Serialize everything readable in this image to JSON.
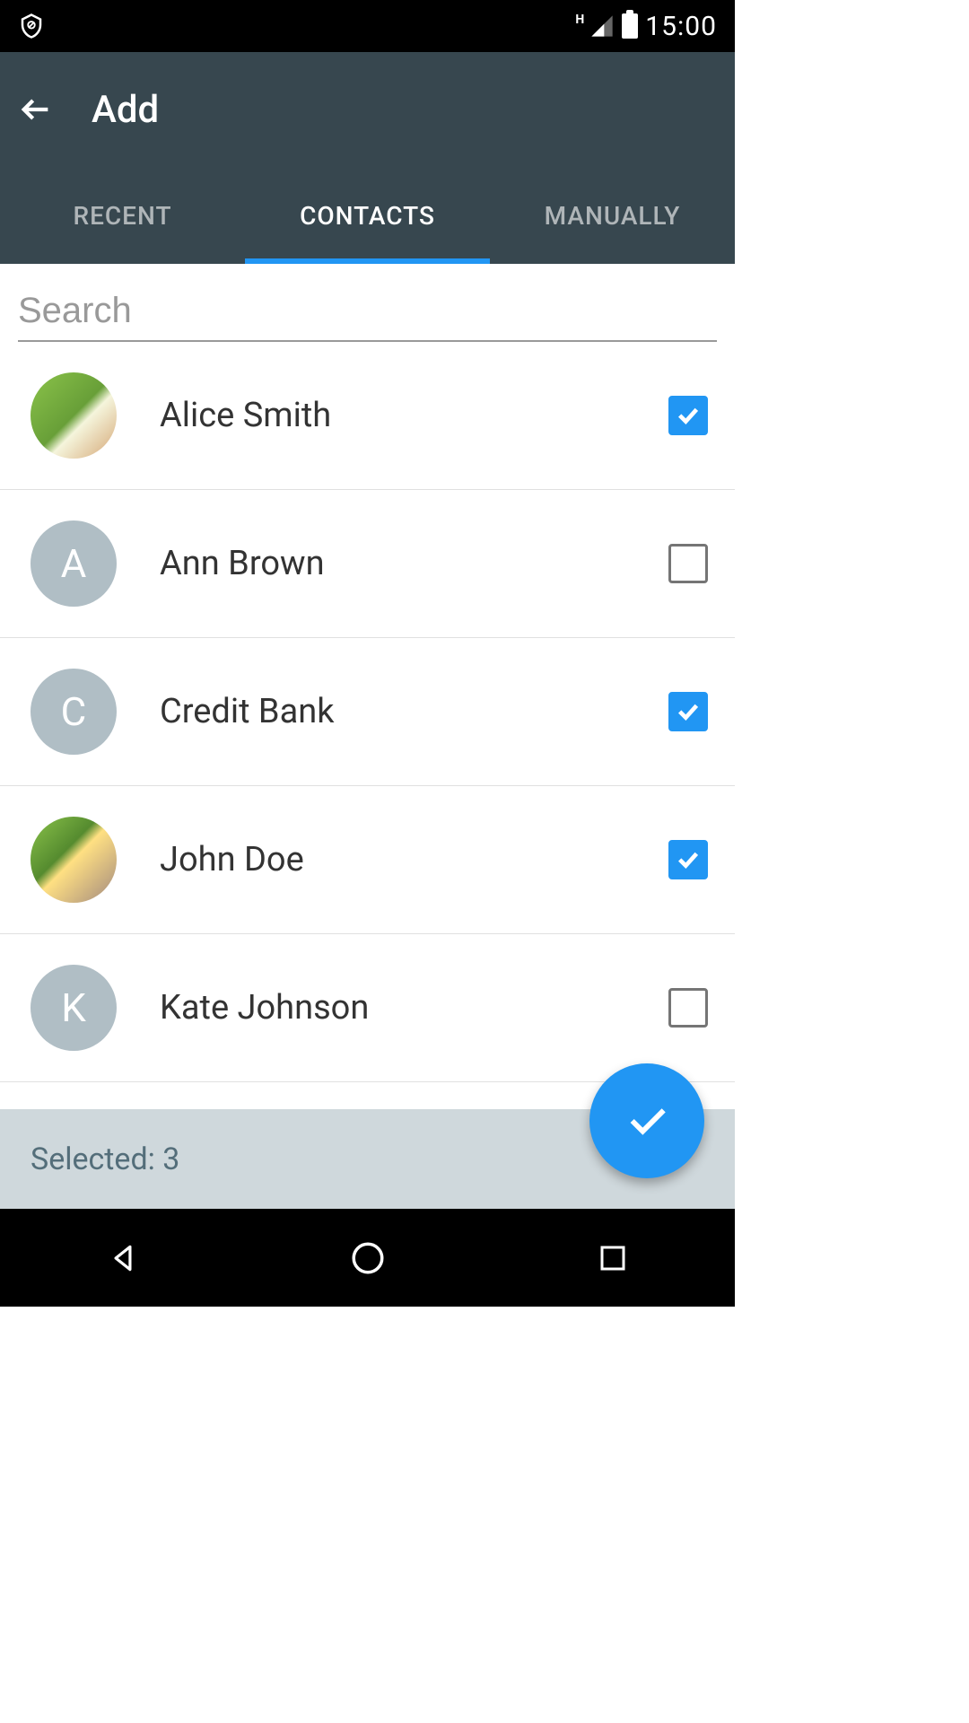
{
  "status_bar": {
    "network_label": "H",
    "time": "15:00"
  },
  "app_bar": {
    "title": "Add"
  },
  "tabs": [
    {
      "label": "RECENT",
      "active": false
    },
    {
      "label": "CONTACTS",
      "active": true
    },
    {
      "label": "MANUALLY",
      "active": false
    }
  ],
  "search": {
    "placeholder": "Search",
    "value": ""
  },
  "contacts": [
    {
      "name": "Alice Smith",
      "initial": "",
      "has_photo": true,
      "photo_class": "photo1",
      "checked": true
    },
    {
      "name": "Ann Brown",
      "initial": "A",
      "has_photo": false,
      "photo_class": "",
      "checked": false
    },
    {
      "name": "Credit Bank",
      "initial": "C",
      "has_photo": false,
      "photo_class": "",
      "checked": true
    },
    {
      "name": "John Doe",
      "initial": "",
      "has_photo": true,
      "photo_class": "photo2",
      "checked": true
    },
    {
      "name": "Kate Johnson",
      "initial": "K",
      "has_photo": false,
      "photo_class": "",
      "checked": false
    }
  ],
  "selected": {
    "label": "Selected: 3"
  },
  "colors": {
    "accent": "#2196f3",
    "header_bg": "#37474f",
    "avatar_bg": "#b0bec5",
    "selected_bar_bg": "#cfd8dc"
  }
}
